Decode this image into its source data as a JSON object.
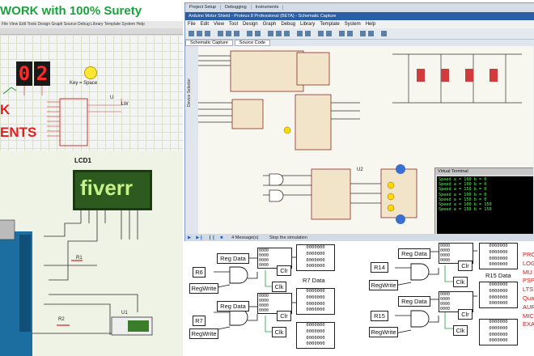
{
  "headline": "WORK with 100% Surety",
  "left_top": {
    "menubar": "File  View  Edit  Tools  Design  Graph  Source  Debug  Library  Template  System  Help",
    "seven_segment_digits": [
      "0",
      "2"
    ],
    "red_label_1": "K",
    "red_label_2": "ENTS",
    "probe_label": "Key = Space",
    "pin_labels": [
      "U",
      "LW"
    ]
  },
  "left_bottom": {
    "lcd_label": "LCD1",
    "lcd_text": "fiverr",
    "resistor_label": "R1",
    "resistor2_label": "R2",
    "module_label": "U1"
  },
  "window": {
    "top_tabs": [
      "Project Setup",
      "Debugging",
      "Instruments"
    ],
    "title": "Arduino Motor Shield - Proteus 8 Professional (BETA) - Schematic Capture",
    "menus": [
      "File",
      "Edit",
      "View",
      "Tool",
      "Design",
      "Graph",
      "Debug",
      "Library",
      "Template",
      "System",
      "Help"
    ],
    "schematic_tabs": [
      "Schematic Capture",
      "Source Code"
    ],
    "side_label": "Device Selector",
    "chip_label": "U2",
    "status_messages": "4 Message(s)",
    "status_text": "Stop the simulation",
    "virtual_terminal": {
      "title": "Virtual Terminal",
      "lines": [
        "Speed a = 100 b = 0",
        "Speed a = 100 b = 0",
        "Speed a = 150 b = 0",
        "Speed a = 100 b = 0",
        "Speed a = 150 b = 0",
        "Speed a = 100 b = 150",
        "Speed a = 150 b = 150"
      ]
    }
  },
  "register_panel": {
    "blocks": [
      {
        "reg_data": "Reg Data",
        "reg_in": "R6",
        "reg_write": "RegWrite",
        "clr": "Clr",
        "clk": "Clk",
        "caption": ""
      },
      {
        "reg_data": "Reg Data",
        "reg_in": "R7",
        "reg_write": "RegWrite",
        "clr": "Clr",
        "clk": "Clk",
        "caption": "R7 Data"
      },
      {
        "reg_data": "Reg Data",
        "reg_in": "R14",
        "reg_write": "RegWrite",
        "clr": "Clr",
        "clk": "Clk",
        "caption": "R15 Data"
      },
      {
        "reg_data": "Reg Data",
        "reg_in": "R15",
        "reg_write": "RegWrite",
        "clr": "Clr",
        "clk": "Clk",
        "caption": ""
      }
    ],
    "zero_row": "0000000",
    "mini_register": "0000\n0000\n0000\n0000",
    "side_list": [
      "PRO",
      "LOG",
      "MU",
      "PSP",
      "LTS",
      "Qua",
      "AUR",
      "MIC",
      "EXA"
    ]
  },
  "colors": {
    "headline_green": "#1aa33a",
    "red_text": "#e02020",
    "lcd_green": "#2d5a1e",
    "terminal_green": "#4dff4d",
    "window_title_blue": "#2a5fa8"
  }
}
